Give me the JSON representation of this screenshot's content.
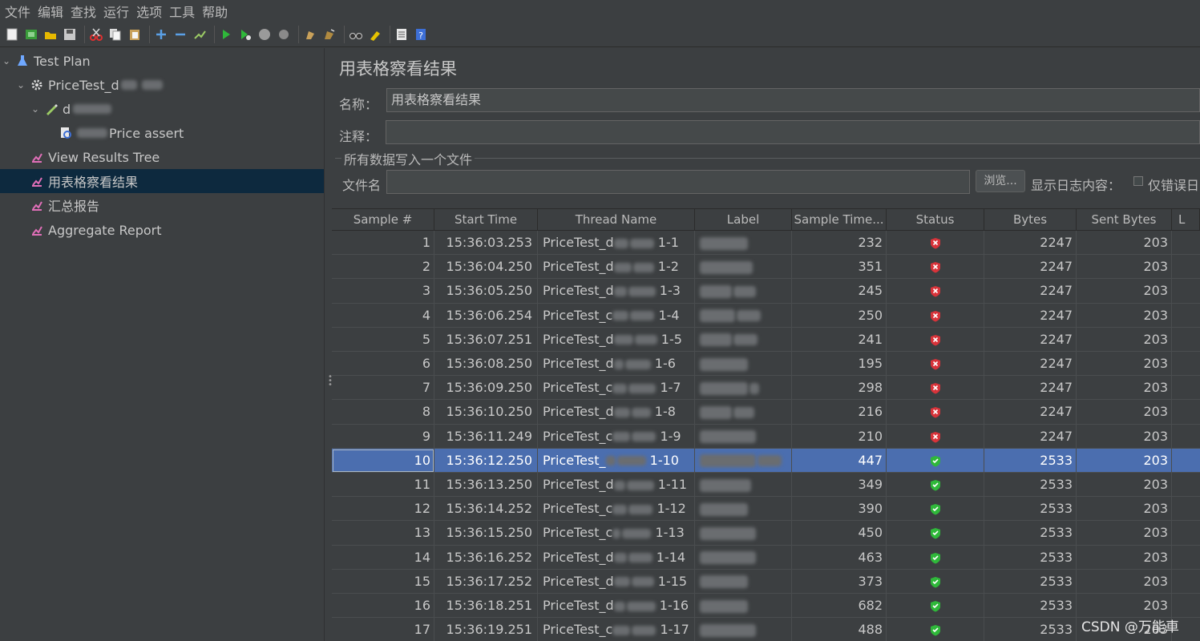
{
  "menu": [
    "文件",
    "编辑",
    "查找",
    "运行",
    "选项",
    "工具",
    "帮助"
  ],
  "toolbar_icons": [
    "new-icon",
    "templates-icon",
    "open-icon",
    "save-icon",
    "cut-icon",
    "copy-icon",
    "paste-icon",
    "expand-icon",
    "collapse-icon",
    "toggle-icon",
    "start-icon",
    "start-no-pause-icon",
    "stop-icon",
    "shutdown-icon",
    "clear-icon",
    "clear-all-icon",
    "search-icon",
    "reset-search-icon",
    "function-helper-icon",
    "help-icon"
  ],
  "tree": {
    "items": [
      {
        "label": "Test Plan",
        "icon": "test-plan-icon"
      },
      {
        "label": "PriceTest_d",
        "icon": "thread-group-icon"
      },
      {
        "label": "d",
        "icon": "sampler-icon"
      },
      {
        "label": "Price assert",
        "icon": "assertion-icon"
      },
      {
        "label": "View Results Tree",
        "icon": "listener-icon"
      },
      {
        "label": "用表格察看结果",
        "icon": "listener-icon"
      },
      {
        "label": "汇总报告",
        "icon": "listener-icon"
      },
      {
        "label": "Aggregate Report",
        "icon": "listener-icon"
      }
    ]
  },
  "panel": {
    "title": "用表格察看结果",
    "name_label": "名称：",
    "name_value": "用表格察看结果",
    "comment_label": "注释：",
    "comment_value": "",
    "file_group_title": "所有数据写入一个文件",
    "filename_label": "文件名",
    "filename_value": "",
    "browse_button": "浏览...",
    "log_label": "显示日志内容：",
    "errors_only_label": "仅错误日"
  },
  "table": {
    "columns": [
      "Sample #",
      "Start Time",
      "Thread Name",
      "Label",
      "Sample Time...",
      "Status",
      "Bytes",
      "Sent Bytes",
      "L"
    ],
    "rows": [
      {
        "n": "1",
        "t": "15:36:03.253",
        "thread": "PriceTest_d",
        "suffix": "1-1",
        "ms": "232",
        "ok": false,
        "bytes": "2247",
        "sent": "203"
      },
      {
        "n": "2",
        "t": "15:36:04.250",
        "thread": "PriceTest_d",
        "suffix": "1-2",
        "ms": "351",
        "ok": false,
        "bytes": "2247",
        "sent": "203"
      },
      {
        "n": "3",
        "t": "15:36:05.250",
        "thread": "PriceTest_d",
        "suffix": "1-3",
        "ms": "245",
        "ok": false,
        "bytes": "2247",
        "sent": "203"
      },
      {
        "n": "4",
        "t": "15:36:06.254",
        "thread": "PriceTest_c",
        "suffix": "1-4",
        "ms": "250",
        "ok": false,
        "bytes": "2247",
        "sent": "203"
      },
      {
        "n": "5",
        "t": "15:36:07.251",
        "thread": "PriceTest_d",
        "suffix": "1-5",
        "ms": "241",
        "ok": false,
        "bytes": "2247",
        "sent": "203"
      },
      {
        "n": "6",
        "t": "15:36:08.250",
        "thread": "PriceTest_d",
        "suffix": "1-6",
        "ms": "195",
        "ok": false,
        "bytes": "2247",
        "sent": "203"
      },
      {
        "n": "7",
        "t": "15:36:09.250",
        "thread": "PriceTest_c",
        "suffix": "1-7",
        "ms": "298",
        "ok": false,
        "bytes": "2247",
        "sent": "203"
      },
      {
        "n": "8",
        "t": "15:36:10.250",
        "thread": "PriceTest_d",
        "suffix": "1-8",
        "ms": "216",
        "ok": false,
        "bytes": "2247",
        "sent": "203"
      },
      {
        "n": "9",
        "t": "15:36:11.249",
        "thread": "PriceTest_c",
        "suffix": "1-9",
        "ms": "210",
        "ok": false,
        "bytes": "2247",
        "sent": "203"
      },
      {
        "n": "10",
        "t": "15:36:12.250",
        "thread": "PriceTest_",
        "suffix": "1-10",
        "ms": "447",
        "ok": true,
        "bytes": "2533",
        "sent": "203"
      },
      {
        "n": "11",
        "t": "15:36:13.250",
        "thread": "PriceTest_d",
        "suffix": "1-11",
        "ms": "349",
        "ok": true,
        "bytes": "2533",
        "sent": "203"
      },
      {
        "n": "12",
        "t": "15:36:14.252",
        "thread": "PriceTest_c",
        "suffix": "1-12",
        "ms": "390",
        "ok": true,
        "bytes": "2533",
        "sent": "203"
      },
      {
        "n": "13",
        "t": "15:36:15.250",
        "thread": "PriceTest_c",
        "suffix": "1-13",
        "ms": "450",
        "ok": true,
        "bytes": "2533",
        "sent": "203"
      },
      {
        "n": "14",
        "t": "15:36:16.252",
        "thread": "PriceTest_d",
        "suffix": "1-14",
        "ms": "463",
        "ok": true,
        "bytes": "2533",
        "sent": "203"
      },
      {
        "n": "15",
        "t": "15:36:17.252",
        "thread": "PriceTest_d",
        "suffix": "1-15",
        "ms": "373",
        "ok": true,
        "bytes": "2533",
        "sent": "203"
      },
      {
        "n": "16",
        "t": "15:36:18.251",
        "thread": "PriceTest_d",
        "suffix": "1-16",
        "ms": "682",
        "ok": true,
        "bytes": "2533",
        "sent": "203"
      },
      {
        "n": "17",
        "t": "15:36:19.251",
        "thread": "PriceTest_c",
        "suffix": "1-17",
        "ms": "488",
        "ok": true,
        "bytes": "2533",
        "sent": "203"
      }
    ],
    "selected_row": "10"
  },
  "colors": {
    "success": "#2fb83a",
    "error": "#d8333a",
    "selection": "#4b6eaf"
  },
  "watermark": "CSDN @万能車"
}
